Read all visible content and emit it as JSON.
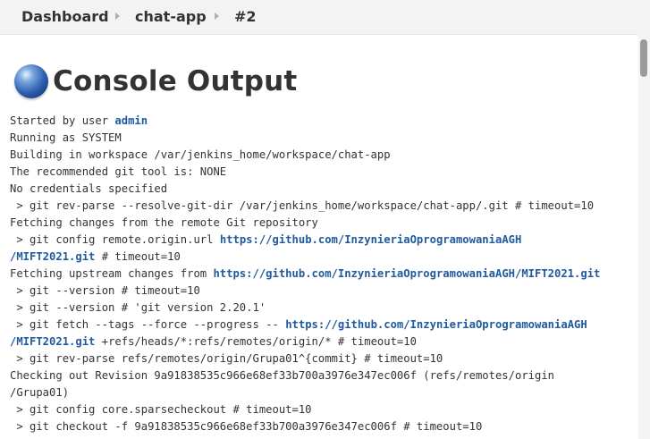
{
  "breadcrumb": [
    "Dashboard",
    "chat-app",
    "#2"
  ],
  "title": "Console Output",
  "console": {
    "lines": [
      [
        {
          "t": "Started by user "
        },
        {
          "t": "admin",
          "link": true
        }
      ],
      [
        {
          "t": "Running as SYSTEM"
        }
      ],
      [
        {
          "t": "Building in workspace /var/jenkins_home/workspace/chat-app"
        }
      ],
      [
        {
          "t": "The recommended git tool is: NONE"
        }
      ],
      [
        {
          "t": "No credentials specified"
        }
      ],
      [
        {
          "t": " > git rev-parse --resolve-git-dir /var/jenkins_home/workspace/chat-app/.git # timeout=10"
        }
      ],
      [
        {
          "t": "Fetching changes from the remote Git repository"
        }
      ],
      [
        {
          "t": " > git config remote.origin.url "
        },
        {
          "t": "https://github.com/InzynieriaOprogramowaniaAGH",
          "link": true
        }
      ],
      [
        {
          "t": "/MIFT2021.git",
          "link": true
        },
        {
          "t": " # timeout=10"
        }
      ],
      [
        {
          "t": "Fetching upstream changes from "
        },
        {
          "t": "https://github.com/InzynieriaOprogramowaniaAGH/MIFT2021.git",
          "link": true
        }
      ],
      [
        {
          "t": " > git --version # timeout=10"
        }
      ],
      [
        {
          "t": " > git --version # 'git version 2.20.1'"
        }
      ],
      [
        {
          "t": " > git fetch --tags --force --progress -- "
        },
        {
          "t": "https://github.com/InzynieriaOprogramowaniaAGH",
          "link": true
        }
      ],
      [
        {
          "t": "/MIFT2021.git",
          "link": true
        },
        {
          "t": " +refs/heads/*:refs/remotes/origin/* # timeout=10"
        }
      ],
      [
        {
          "t": " > git rev-parse refs/remotes/origin/Grupa01^{commit} # timeout=10"
        }
      ],
      [
        {
          "t": "Checking out Revision 9a91838535c966e68ef33b700a3976e347ec006f (refs/remotes/origin"
        }
      ],
      [
        {
          "t": "/Grupa01)"
        }
      ],
      [
        {
          "t": " > git config core.sparsecheckout # timeout=10"
        }
      ],
      [
        {
          "t": " > git checkout -f 9a91838535c966e68ef33b700a3976e347ec006f # timeout=10"
        }
      ]
    ]
  }
}
